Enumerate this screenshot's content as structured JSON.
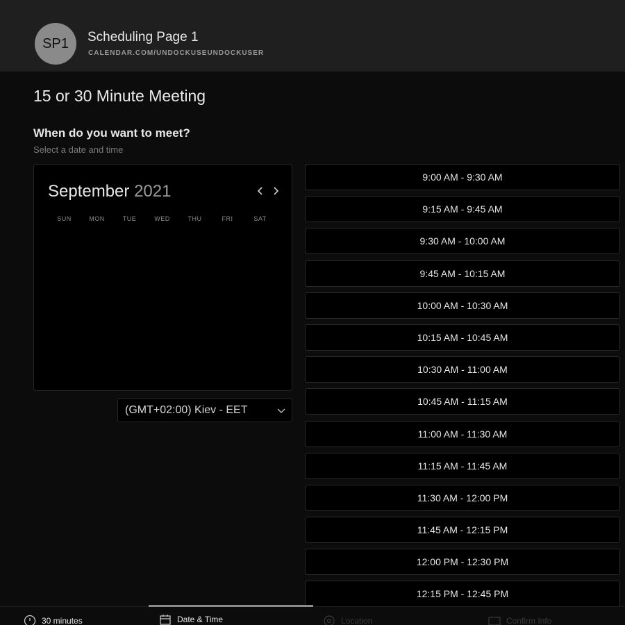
{
  "header": {
    "avatar_initials": "SP1",
    "title": "Scheduling Page 1",
    "url": "CALENDAR.COM/UNDOCKUSEUNDOCKUSER"
  },
  "meeting": {
    "title": "15 or 30 Minute Meeting"
  },
  "prompt": {
    "question": "When do you want to meet?",
    "subtitle": "Select a date and time"
  },
  "calendar": {
    "month": "September",
    "year": "2021",
    "weekdays": [
      "SUN",
      "MON",
      "TUE",
      "WED",
      "THU",
      "FRI",
      "SAT"
    ]
  },
  "timezone": {
    "selected": "(GMT+02:00) Kiev - EET"
  },
  "slots": [
    "9:00 AM - 9:30 AM",
    "9:15 AM - 9:45 AM",
    "9:30 AM - 10:00 AM",
    "9:45 AM - 10:15 AM",
    "10:00 AM - 10:30 AM",
    "10:15 AM - 10:45 AM",
    "10:30 AM - 11:00 AM",
    "10:45 AM - 11:15 AM",
    "11:00 AM - 11:30 AM",
    "11:15 AM - 11:45 AM",
    "11:30 AM - 12:00 PM",
    "11:45 AM - 12:15 PM",
    "12:00 PM - 12:30 PM",
    "12:15 PM - 12:45 PM"
  ],
  "steps": [
    {
      "label": "30 minutes",
      "icon": "clock-icon",
      "active": true
    },
    {
      "label": "Date & Time",
      "icon": "calendar-icon",
      "active": true
    },
    {
      "label": "Location",
      "icon": "location-icon",
      "active": false
    },
    {
      "label": "Confirm Info",
      "icon": "card-icon",
      "active": false
    }
  ],
  "colors": {
    "background": "#0c0c0c",
    "header": "#1f1f1f",
    "avatar": "#8a8a8a"
  }
}
